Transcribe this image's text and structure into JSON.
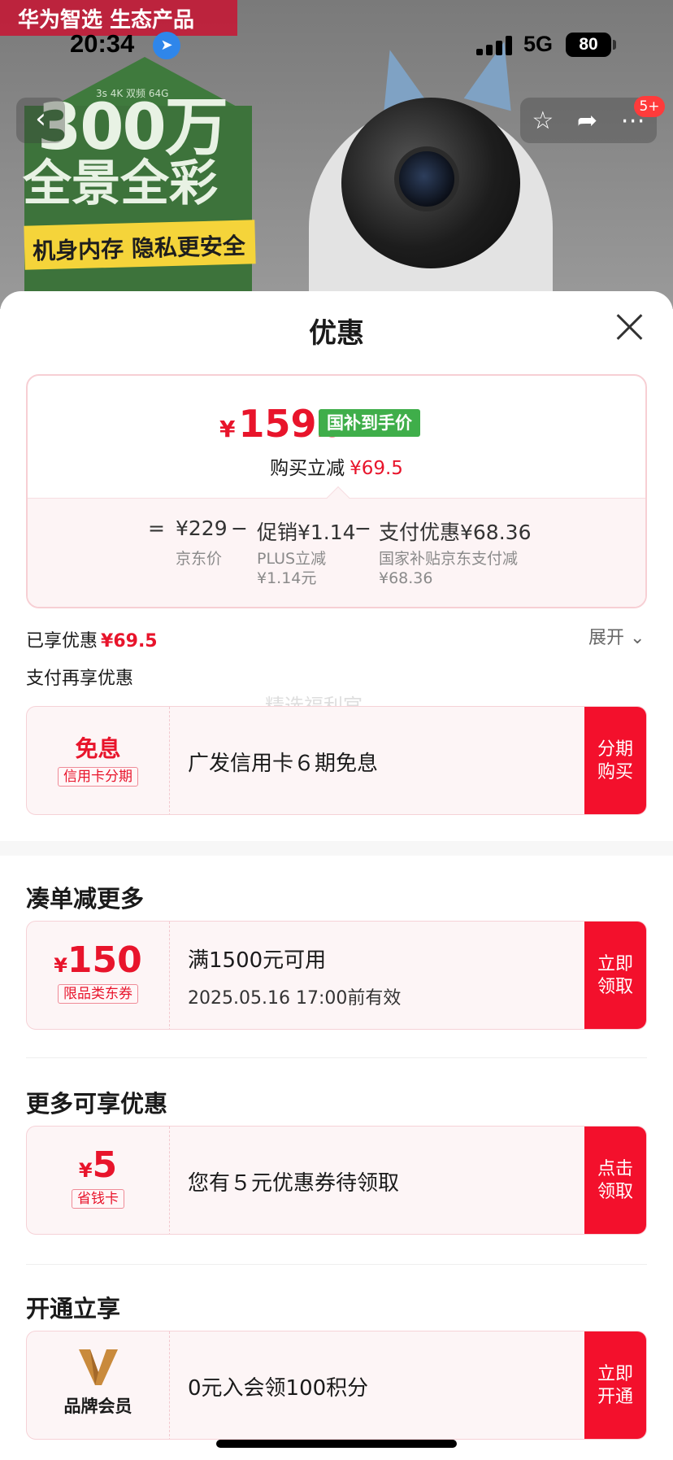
{
  "background": {
    "ribbon": "华为智选 生态产品",
    "poster_spec": "3s 4K 双频 64G",
    "poster_line1": "300万",
    "poster_line2": "全景全彩",
    "poster_line3": "机身内存 隐私更安全"
  },
  "status_bar": {
    "time": "20:34",
    "network": "5G",
    "battery": "80"
  },
  "nav": {
    "badge": "5+"
  },
  "sheet": {
    "title": "优惠",
    "price": {
      "currency": "¥",
      "integer": "159",
      "decimal": ".5",
      "tag": "国补到手价",
      "sub_label": "购买立减",
      "sub_value": "¥69.5"
    },
    "formula": {
      "equals": "=",
      "base": "¥229",
      "minus1": "−",
      "promo": "促销¥1.14",
      "minus2": "−",
      "pay": "支付优惠¥68.36",
      "base_label": "京东价",
      "promo_label1": "PLUS立减",
      "promo_label2": "¥1.14元",
      "pay_label1": "国家补贴京东支付减",
      "pay_label2": "¥68.36"
    },
    "enjoyed": {
      "label": "已享优惠",
      "value": "¥69.5",
      "expand": "展开"
    },
    "pay_more_label": "支付再享优惠",
    "watermark": "精选福利官",
    "installment": {
      "big": "免息",
      "tag": "信用卡分期",
      "text": "广发信用卡６期免息",
      "button": "分期购买"
    },
    "section_bundle": {
      "title": "凑单减更多",
      "currency": "¥",
      "amount": "150",
      "tag": "限品类东券",
      "line1": "满1500元可用",
      "line2": "2025.05.16 17:00前有效",
      "button": "立即领取"
    },
    "section_more": {
      "title": "更多可享优惠",
      "currency": "¥",
      "amount": "5",
      "tag": "省钱卡",
      "text": "您有５元优惠券待领取",
      "button": "点击领取"
    },
    "section_open": {
      "title": "开通立享",
      "brand_label": "品牌会员",
      "text": "0元入会领100积分",
      "button": "立即开通"
    }
  },
  "colors": {
    "accent_red": "#e8142b",
    "button_red": "#f3102c",
    "green_tag": "#3fae4a"
  }
}
